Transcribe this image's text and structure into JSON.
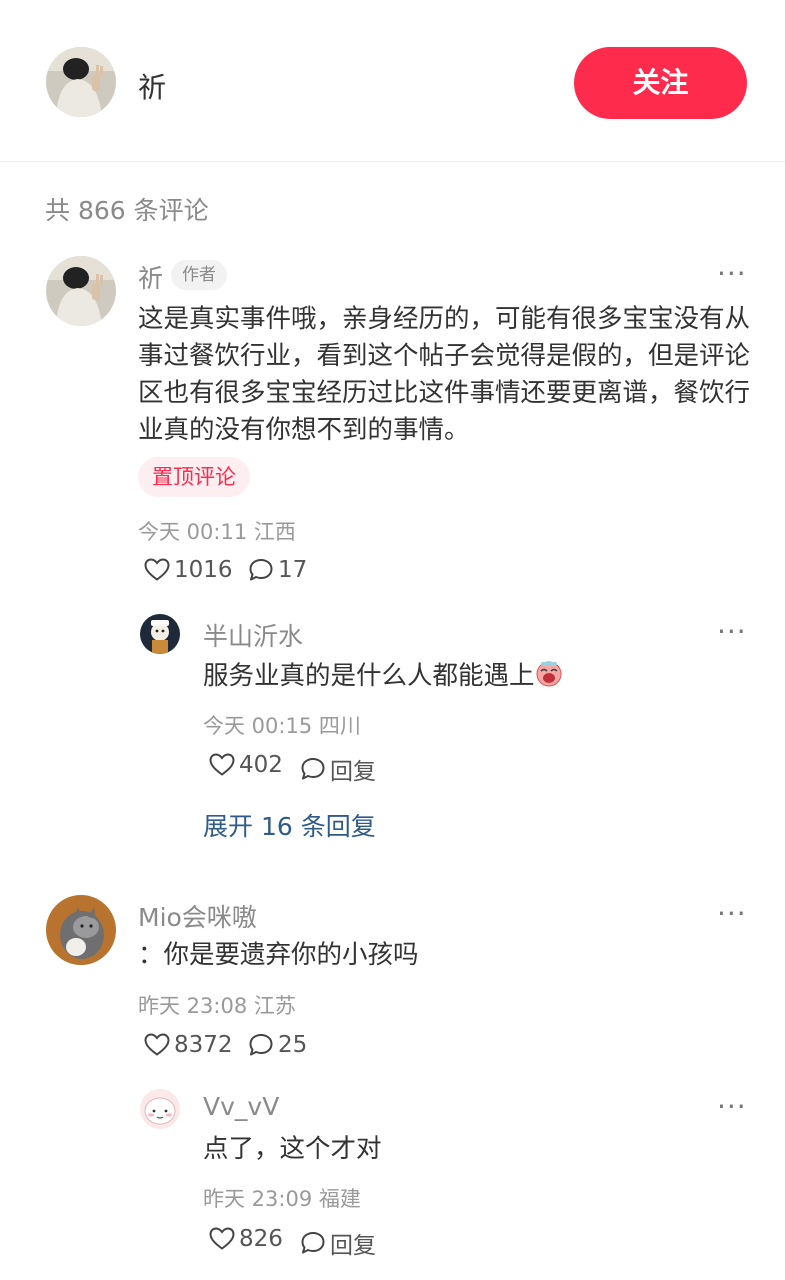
{
  "header": {
    "author_name": "祈",
    "follow_label": "关注"
  },
  "comment_count": "共 866 条评论",
  "comments": [
    {
      "name": "祈",
      "author_tag": "作者",
      "text_lines": [
        "这是真实事件哦，亲身经历的，可能有很多宝宝没有从",
        "事过餐饮行业，看到这个帖子会觉得是假的，但是评论",
        "区也有很多宝宝经历过比这件事情还要更离谱，餐饮行",
        "业真的没有你想不到的事情。"
      ],
      "pin_label": "置顶评论",
      "meta": "今天 00:11 江西",
      "likes": "1016",
      "replies": "17",
      "reply": {
        "name": "半山沂水",
        "text": "服务业真的是什么人都能遇上",
        "meta": "今天 00:15 四川",
        "likes": "402",
        "reply_label": "回复"
      },
      "expand_label": "展开 16 条回复"
    },
    {
      "name": "Mio会咪嗷",
      "text": "：你是要遗弃你的小孩吗",
      "meta": "昨天 23:08 江苏",
      "likes": "8372",
      "replies": "25",
      "reply": {
        "name": "Vv_vV",
        "text": "点了，这个才对",
        "meta": "昨天 23:09 福建",
        "likes": "826",
        "reply_label": "回复"
      }
    }
  ],
  "more_icon": "more-dots-icon",
  "like_icon": "heart-outline-icon",
  "comment_icon": "speech-bubble-icon",
  "colors": {
    "accent": "#ff2b4c",
    "pin_bg": "#fdeef1",
    "link": "#2f5b8a",
    "muted": "#8a8a8a"
  }
}
